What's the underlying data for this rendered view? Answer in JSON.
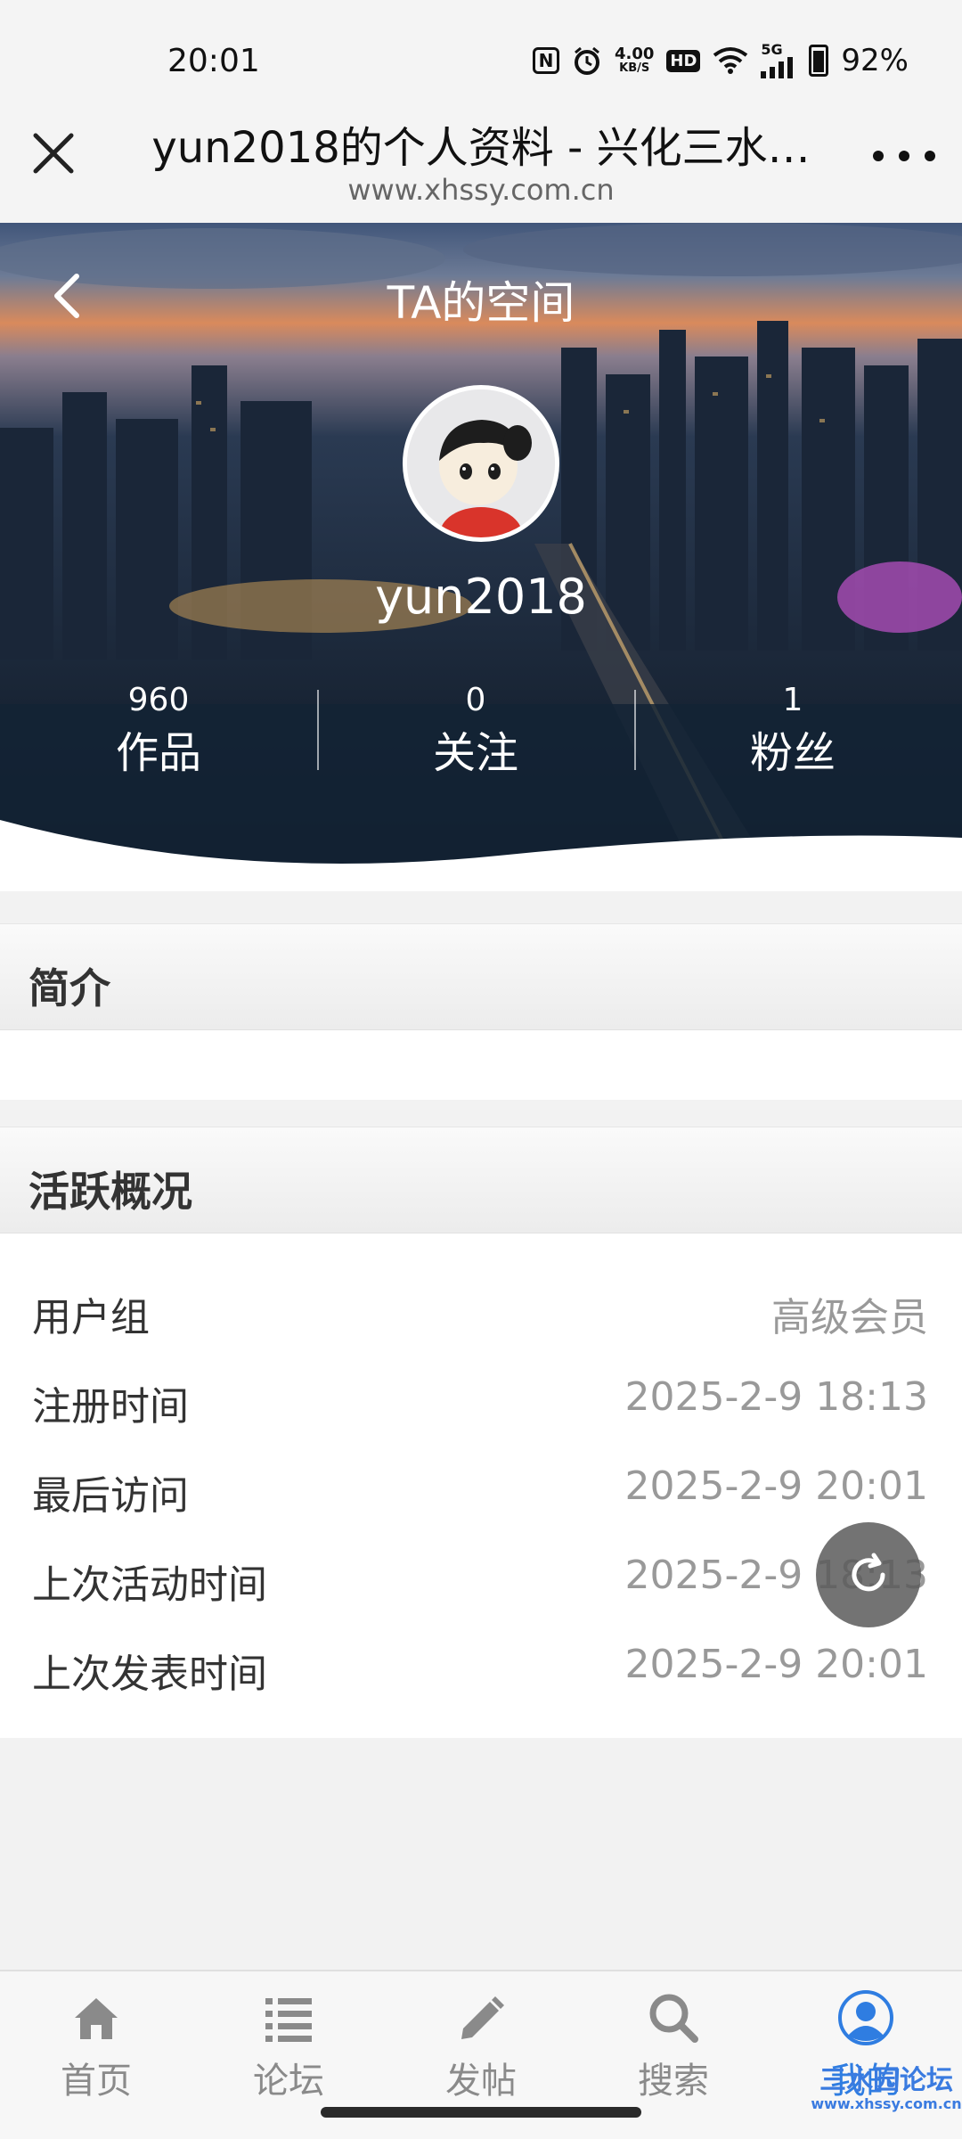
{
  "status_bar": {
    "time": "20:01",
    "net_speed_value": "4.00",
    "net_speed_unit": "KB/S",
    "hd": "HD",
    "signal": "5G",
    "battery": "92%",
    "icons": [
      "nfc-icon",
      "alarm-icon",
      "hd-icon",
      "wifi-icon",
      "signal-icon",
      "battery-icon"
    ]
  },
  "browser": {
    "title": "yun2018的个人资料 - 兴化三水…",
    "url": "www.xhssy.com.cn"
  },
  "hero": {
    "title": "TA的空间",
    "username": "yun2018",
    "stats": [
      {
        "value": "960",
        "label": "作品"
      },
      {
        "value": "0",
        "label": "关注"
      },
      {
        "value": "1",
        "label": "粉丝"
      }
    ]
  },
  "intro": {
    "heading": "简介"
  },
  "activity": {
    "heading": "活跃概况",
    "rows": [
      {
        "label": "用户组",
        "value": "高级会员"
      },
      {
        "label": "注册时间",
        "value": "2025-2-9 18:13"
      },
      {
        "label": "最后访问",
        "value": "2025-2-9 20:01"
      },
      {
        "label": "上次活动时间",
        "value": "2025-2-9 18:13"
      },
      {
        "label": "上次发表时间",
        "value": "2025-2-9 20:01"
      }
    ]
  },
  "bottom_nav": {
    "items": [
      {
        "label": "首页",
        "icon": "home-icon"
      },
      {
        "label": "论坛",
        "icon": "list-icon"
      },
      {
        "label": "发帖",
        "icon": "pencil-icon"
      },
      {
        "label": "搜索",
        "icon": "search-icon"
      },
      {
        "label": "我的",
        "icon": "user-icon",
        "active": true
      }
    ]
  },
  "watermark": {
    "title": "三水园论坛",
    "url": "www.xhssy.com.cn"
  },
  "colors": {
    "accent": "#2f7de1",
    "muted_text": "#999999",
    "page_bg": "#f2f2f2"
  }
}
